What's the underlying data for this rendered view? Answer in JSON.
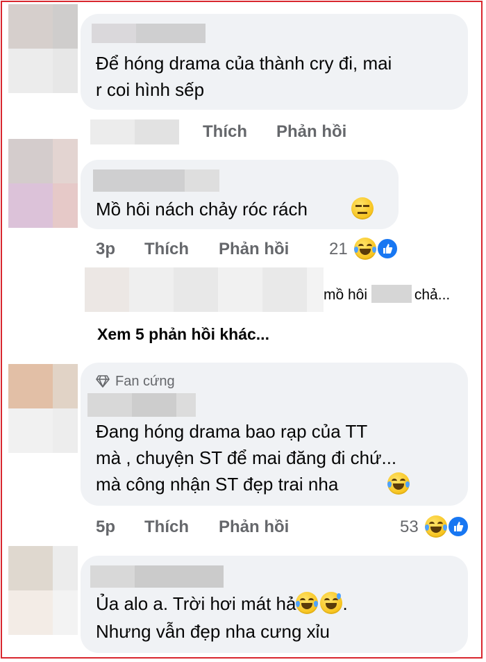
{
  "comments": [
    {
      "text_lines": [
        "Để hóng drama của thành cry đi, mai",
        "r coi hình sếp"
      ],
      "actions": {
        "like": "Thích",
        "reply": "Phản hồi"
      }
    },
    {
      "text_lines": [
        "Mồ hôi nách chảy róc rách"
      ],
      "time": "3p",
      "actions": {
        "like": "Thích",
        "reply": "Phản hồi"
      },
      "reaction_count": "21",
      "reply_preview": {
        "text_start": "mồ hôi ",
        "text_end": "chả..."
      },
      "see_more": "Xem 5 phản hồi khác..."
    },
    {
      "badge": "Fan cứng",
      "text_lines": [
        "Đang hóng drama bao rạp của TT",
        "mà , chuyện ST để mai đăng đi chứ...",
        "mà công nhận ST đẹp trai nha"
      ],
      "time": "5p",
      "actions": {
        "like": "Thích",
        "reply": "Phản hồi"
      },
      "reaction_count": "53"
    },
    {
      "text_lines": [
        "Ủa alo a. Trời hơi mát hả",
        "Nhưng vẫn đẹp nha cưng xỉu"
      ],
      "text_line1_end": "."
    }
  ],
  "colors": {
    "border": "#d8262e",
    "bubble": "#f0f2f5",
    "meta": "#65676b",
    "like_blue": "#1877f2"
  },
  "icons": [
    "expressionless-emoji-icon",
    "laughing-tears-emoji-icon",
    "like-reaction-icon",
    "diamond-icon",
    "sweat-smile-emoji-icon"
  ]
}
